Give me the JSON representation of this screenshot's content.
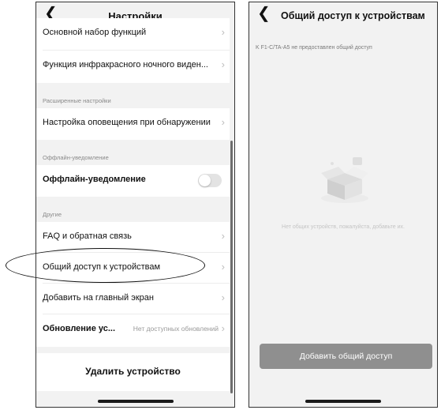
{
  "left": {
    "header": {
      "back_icon": "chevron-left-icon",
      "title": "Настройки"
    },
    "rows": {
      "basic_features": "Основной набор функций",
      "infrared": "Функция инфракрасного ночного виден...",
      "detection_alert": "Настройка оповещения при обнаружении",
      "offline_notification": "Оффлайн-уведомление",
      "faq": "FAQ и обратная связь",
      "device_sharing": "Общий доступ к устройствам",
      "add_home_screen": "Добавить на главный экран",
      "firmware_update": "Обновление ус...",
      "firmware_update_value": "Нет доступных обновлений"
    },
    "sections": {
      "advanced": "Расширенные настройки",
      "offline": "Оффлайн-уведомление",
      "other": "Другие"
    },
    "offline_toggle_on": false,
    "delete_label": "Удалить устройство"
  },
  "right": {
    "header": {
      "back_icon": "chevron-left-icon",
      "title": "Общий доступ к устройствам"
    },
    "notice": "K F1-C/TA-A5 не предоставлен общий доступ",
    "empty_state": "Нет общих устройств, пожалуйста, добавьте их.",
    "empty_illustration": "empty-box-icon",
    "add_button": "Добавить общий доступ"
  },
  "colors": {
    "background": "#f2f2f2",
    "card": "#ffffff",
    "button": "#8f8f8f",
    "chevron": "#bdbdbd"
  }
}
